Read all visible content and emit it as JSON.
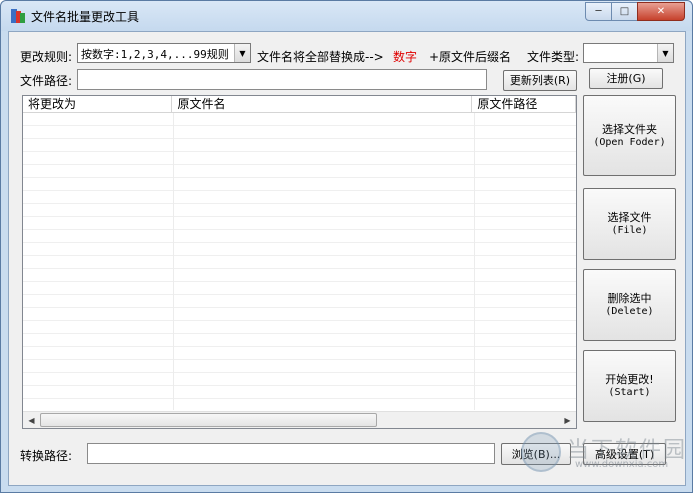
{
  "window": {
    "title": "文件名批量更改工具",
    "controls": {
      "minimize": "─",
      "maximize": "□",
      "close": "✕"
    }
  },
  "row1": {
    "rule_label": "更改规则:",
    "rule_value": "按数字:1,2,3,4,...99规则",
    "replace_text": "文件名将全部替换成-->",
    "replace_target": "数字",
    "suffix_text": "+原文件后缀名",
    "filetype_label": "文件类型:",
    "filetype_value": ""
  },
  "row2": {
    "path_label": "文件路径:",
    "path_value": "",
    "refresh_button": "更新列表(R)",
    "register_button": "注册(G)"
  },
  "list": {
    "columns": [
      "将更改为",
      "原文件名",
      "原文件路径"
    ]
  },
  "side_buttons": [
    {
      "label": "选择文件夹",
      "sub": "(Open Foder)"
    },
    {
      "label": "选择文件",
      "sub": "(File)"
    },
    {
      "label": "删除选中",
      "sub": "(Delete)"
    },
    {
      "label": "开始更改!",
      "sub": "(Start)"
    }
  ],
  "bottom": {
    "convert_label": "转换路径:",
    "convert_value": "",
    "browse_button": "浏览(B)...",
    "advanced_button": "高级设置(T)"
  },
  "watermark": {
    "text": "当下软件园",
    "url": "www.downxia.com"
  }
}
